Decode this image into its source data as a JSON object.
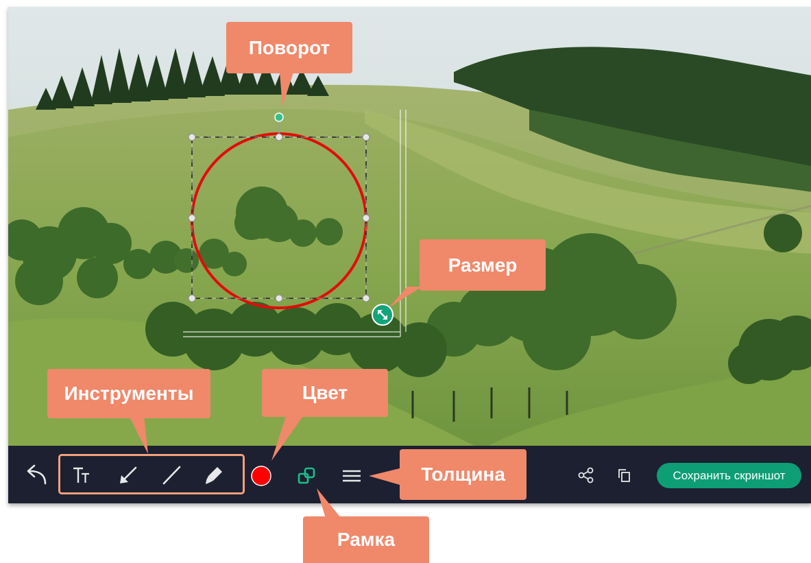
{
  "callouts": {
    "rotate": "Поворот",
    "size": "Размер",
    "tools": "Инструменты",
    "color": "Цвет",
    "thickness": "Толщина",
    "frame": "Рамка"
  },
  "toolbar": {
    "undo_icon": "undo-arrow",
    "text_tool_icon": "text-Tt",
    "arrow_tool_icon": "arrow-diagonal",
    "line_tool_icon": "line-diagonal",
    "marker_tool_icon": "marker-pen",
    "current_color": "#ff0000",
    "frame_icon": "overlapping-squares",
    "frame_icon_color": "#19c08a",
    "thickness_icon": "three-horizontal-lines",
    "share_icon": "share-nodes",
    "copy_icon": "copy-squares",
    "save_label": "Сохранить скриншот",
    "save_color": "#0e9e76"
  },
  "colors": {
    "callout": "#f0886a",
    "toolbar_bg": "#1c2030",
    "annotation_stroke": "#e30b0b",
    "handle_rotate": "#35c08a",
    "resize_handle": "#12a47a"
  }
}
